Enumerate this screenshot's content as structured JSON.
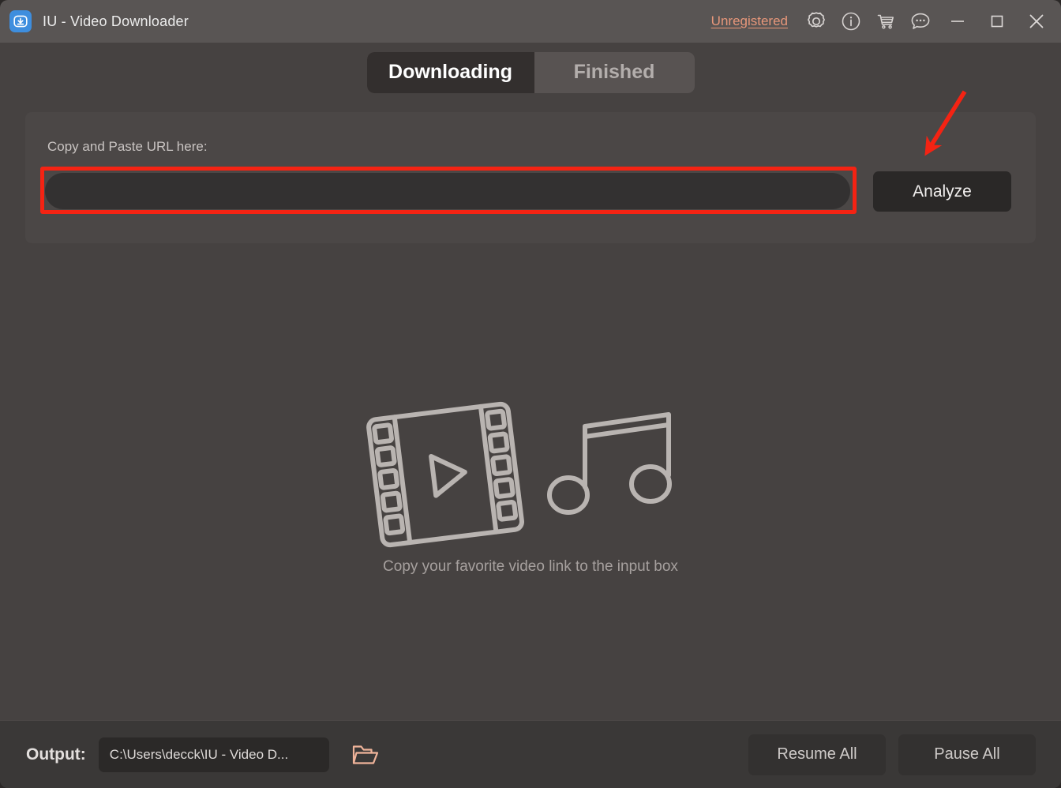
{
  "window": {
    "title": "IU - Video Downloader",
    "app_icon": "download-box-icon",
    "accent_color": "#e8977a",
    "background_color": "#464241",
    "titlebar_color": "#595554"
  },
  "titlebar": {
    "unregistered_label": "Unregistered",
    "icons": [
      {
        "name": "gear-icon",
        "label": "Settings"
      },
      {
        "name": "info-icon",
        "label": "Information"
      },
      {
        "name": "cart-icon",
        "label": "Buy"
      },
      {
        "name": "chat-icon",
        "label": "Feedback"
      }
    ],
    "minimize_label": "Minimize",
    "maximize_label": "Maximize",
    "close_label": "Close"
  },
  "tabs": [
    {
      "label": "Downloading",
      "active": true
    },
    {
      "label": "Finished",
      "active": false
    }
  ],
  "url_panel": {
    "label": "Copy and Paste URL here:",
    "input_value": "",
    "input_placeholder": "",
    "analyze_label": "Analyze",
    "highlight_color": "#f42313"
  },
  "empty_state": {
    "caption": "Copy your favorite video link to the input box",
    "illustration": "film-strip-and-music-note-icon"
  },
  "bottom_bar": {
    "output_label": "Output:",
    "output_path": "C:\\Users\\decck\\IU - Video D...",
    "folder_icon": "open-folder-icon",
    "resume_all_label": "Resume All",
    "pause_all_label": "Pause All"
  }
}
